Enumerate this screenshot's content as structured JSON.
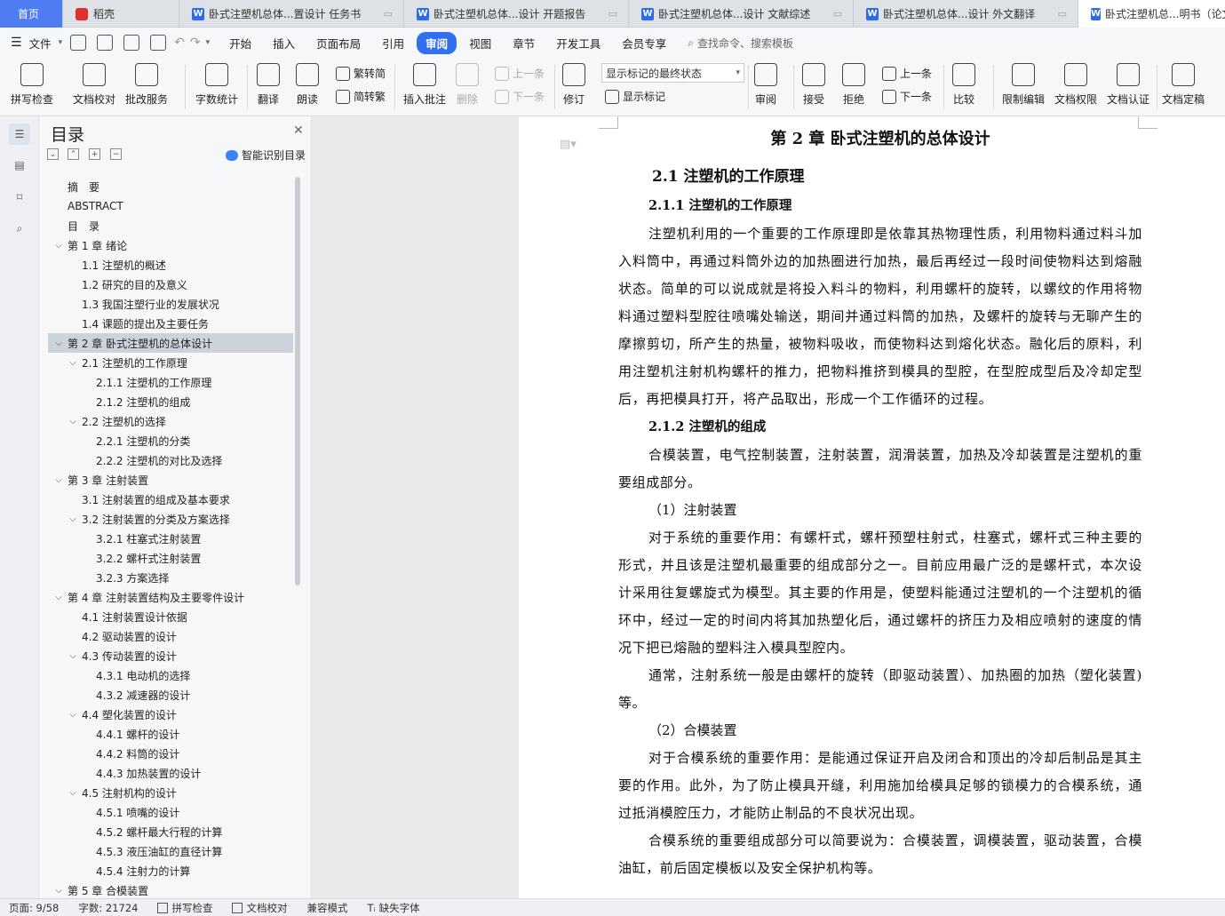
{
  "tabs": [
    {
      "label": "首页"
    },
    {
      "label": "稻壳"
    },
    {
      "label": "卧式注塑机总体...置设计 任务书"
    },
    {
      "label": "卧式注塑机总体...设计 开题报告"
    },
    {
      "label": "卧式注塑机总体...设计 文献综述"
    },
    {
      "label": "卧式注塑机总体...设计 外文翻译"
    },
    {
      "label": "卧式注塑机总...明书（论文"
    }
  ],
  "menu": {
    "file": "文件",
    "items": [
      "开始",
      "插入",
      "页面布局",
      "引用",
      "审阅",
      "视图",
      "章节",
      "开发工具",
      "会员专享"
    ],
    "active": "审阅",
    "search_placeholder": "查找命令、搜索模板"
  },
  "ribbon": {
    "spellcheck": "拼写检查",
    "doc_proof": "文档校对",
    "batch_service": "批改服务",
    "word_count": "字数统计",
    "translate": "翻译",
    "read_aloud": "朗读",
    "trad_to_simp": "繁转简",
    "simp_to_trad": "简转繁",
    "insert_comment": "插入批注",
    "delete": "删除",
    "prev_comment": "上一条",
    "next_comment": "下一条",
    "revise": "修订",
    "markup_select": "显示标记的最终状态",
    "show_markup": "显示标记",
    "review": "审阅",
    "accept": "接受",
    "reject": "拒绝",
    "prev_change": "上一条",
    "next_change": "下一条",
    "compare": "比较",
    "restrict_edit": "限制编辑",
    "doc_permission": "文档权限",
    "doc_cert": "文档认证",
    "doc_finalize": "文档定稿"
  },
  "toc": {
    "title": "目录",
    "smart_label": "智能识别目录",
    "items": [
      {
        "text": "摘　要",
        "level": 0,
        "chev": ""
      },
      {
        "text": "ABSTRACT",
        "level": 0,
        "chev": ""
      },
      {
        "text": "目　录",
        "level": 0,
        "chev": ""
      },
      {
        "text": "第 1 章  绪论",
        "level": 0,
        "chev": "v"
      },
      {
        "text": "1.1  注塑机的概述",
        "level": 1,
        "chev": ""
      },
      {
        "text": "1.2  研究的目的及意义",
        "level": 1,
        "chev": ""
      },
      {
        "text": "1.3  我国注塑行业的发展状况",
        "level": 1,
        "chev": ""
      },
      {
        "text": "1.4  课题的提出及主要任务",
        "level": 1,
        "chev": ""
      },
      {
        "text": "第 2 章  卧式注塑机的总体设计",
        "level": 0,
        "chev": "v",
        "selected": true
      },
      {
        "text": "2.1 注塑机的工作原理",
        "level": 1,
        "chev": "v"
      },
      {
        "text": "2.1.1 注塑机的工作原理",
        "level": 2,
        "chev": ""
      },
      {
        "text": "2.1.2 注塑机的组成",
        "level": 2,
        "chev": ""
      },
      {
        "text": "2.2  注塑机的选择",
        "level": 1,
        "chev": "v"
      },
      {
        "text": "2.2.1 注塑机的分类",
        "level": 2,
        "chev": ""
      },
      {
        "text": "2.2.2 注塑机的对比及选择",
        "level": 2,
        "chev": ""
      },
      {
        "text": "第 3 章  注射装置",
        "level": 0,
        "chev": "v"
      },
      {
        "text": "3.1  注射装置的组成及基本要求",
        "level": 1,
        "chev": ""
      },
      {
        "text": "3.2  注射装置的分类及方案选择",
        "level": 1,
        "chev": "v"
      },
      {
        "text": "3.2.1 柱塞式注射装置",
        "level": 2,
        "chev": ""
      },
      {
        "text": "3.2.2  螺杆式注射装置",
        "level": 2,
        "chev": ""
      },
      {
        "text": "3.2.3  方案选择",
        "level": 2,
        "chev": ""
      },
      {
        "text": "第 4 章  注射装置结构及主要零件设计",
        "level": 0,
        "chev": "v"
      },
      {
        "text": "4.1 注射装置设计依据",
        "level": 1,
        "chev": ""
      },
      {
        "text": "4.2 驱动装置的设计",
        "level": 1,
        "chev": ""
      },
      {
        "text": "4.3 传动装置的设计",
        "level": 1,
        "chev": "v"
      },
      {
        "text": "4.3.1 电动机的选择",
        "level": 2,
        "chev": ""
      },
      {
        "text": "4.3.2 减速器的设计",
        "level": 2,
        "chev": ""
      },
      {
        "text": "4.4 塑化装置的设计",
        "level": 1,
        "chev": "v"
      },
      {
        "text": "4.4.1  螺杆的设计",
        "level": 2,
        "chev": ""
      },
      {
        "text": "4.4.2 料筒的设计",
        "level": 2,
        "chev": ""
      },
      {
        "text": "4.4.3 加热装置的设计",
        "level": 2,
        "chev": ""
      },
      {
        "text": "4.5 注射机构的设计",
        "level": 1,
        "chev": "v"
      },
      {
        "text": "4.5.1 喷嘴的设计",
        "level": 2,
        "chev": ""
      },
      {
        "text": "4.5.2 螺杆最大行程的计算",
        "level": 2,
        "chev": ""
      },
      {
        "text": "4.5.3  液压油缸的直径计算",
        "level": 2,
        "chev": ""
      },
      {
        "text": "4.5.4 注射力的计算",
        "level": 2,
        "chev": ""
      },
      {
        "text": "第 5 章  合模装置",
        "level": 0,
        "chev": "v"
      }
    ]
  },
  "document": {
    "chapter_title": "第 2 章  卧式注塑机的总体设计",
    "section_title": "2.1 注塑机的工作原理",
    "subsection1_title": "2.1.1 注塑机的工作原理",
    "para1": "注塑机利用的一个重要的工作原理即是依靠其热物理性质，利用物料通过料斗加入料筒中，再通过料筒外边的加热圈进行加热，最后再经过一段时间使物料达到熔融状态。简单的可以说成就是将投入料斗的物料，利用螺杆的旋转，以螺纹的作用将物料通过塑料型腔往喷嘴处输送，期间并通过料筒的加热，及螺杆的旋转与无聊产生的摩擦剪切，所产生的热量，被物料吸收，而使物料达到熔化状态。融化后的原料，利用注塑机注射机构螺杆的推力，把物料推挤到模具的型腔，在型腔成型后及冷却定型后，再把模具打开，将产品取出，形成一个工作循环的过程。",
    "subsection2_title": "2.1.2 注塑机的组成",
    "para2": "合模装置，电气控制装置，注射装置，润滑装置，加热及冷却装置是注塑机的重要组成部分。",
    "list1": "（1）注射装置",
    "para3": "对于系统的重要作用：有螺杆式，螺杆预塑柱射式，柱塞式，螺杆式三种主要的形式，并且该是注塑机最重要的组成部分之一。目前应用最广泛的是螺杆式，本次设计采用往复螺旋式为模型。其主要的作用是，使塑料能通过注塑机的一个注塑机的循环中，经过一定的时间内将其加热塑化后，通过螺杆的挤压力及相应喷射的速度的情况下把已熔融的塑料注入模具型腔内。",
    "para4": "通常，注射系统一般是由螺杆的旋转（即驱动装置）、加热圈的加热（塑化装置)等。",
    "list2": "（2）合模装置",
    "para5": "对于合模系统的重要作用：是能通过保证开启及闭合和顶出的冷却后制品是其主要的作用。此外，为了防止模具开缝，利用施加给模具足够的锁模力的合模系统，通过抵消模腔压力，才能防止制品的不良状况出现。",
    "para6": "合模系统的重要组成部分可以简要说为：合模装置，调模装置，驱动装置，合模油缸，前后固定模板以及安全保护机构等。"
  },
  "status": {
    "page": "页面: 9/58",
    "words": "字数: 21724",
    "spell": "拼写检查",
    "proof": "文档校对",
    "compat": "兼容模式",
    "missing_font": "缺失字体"
  }
}
